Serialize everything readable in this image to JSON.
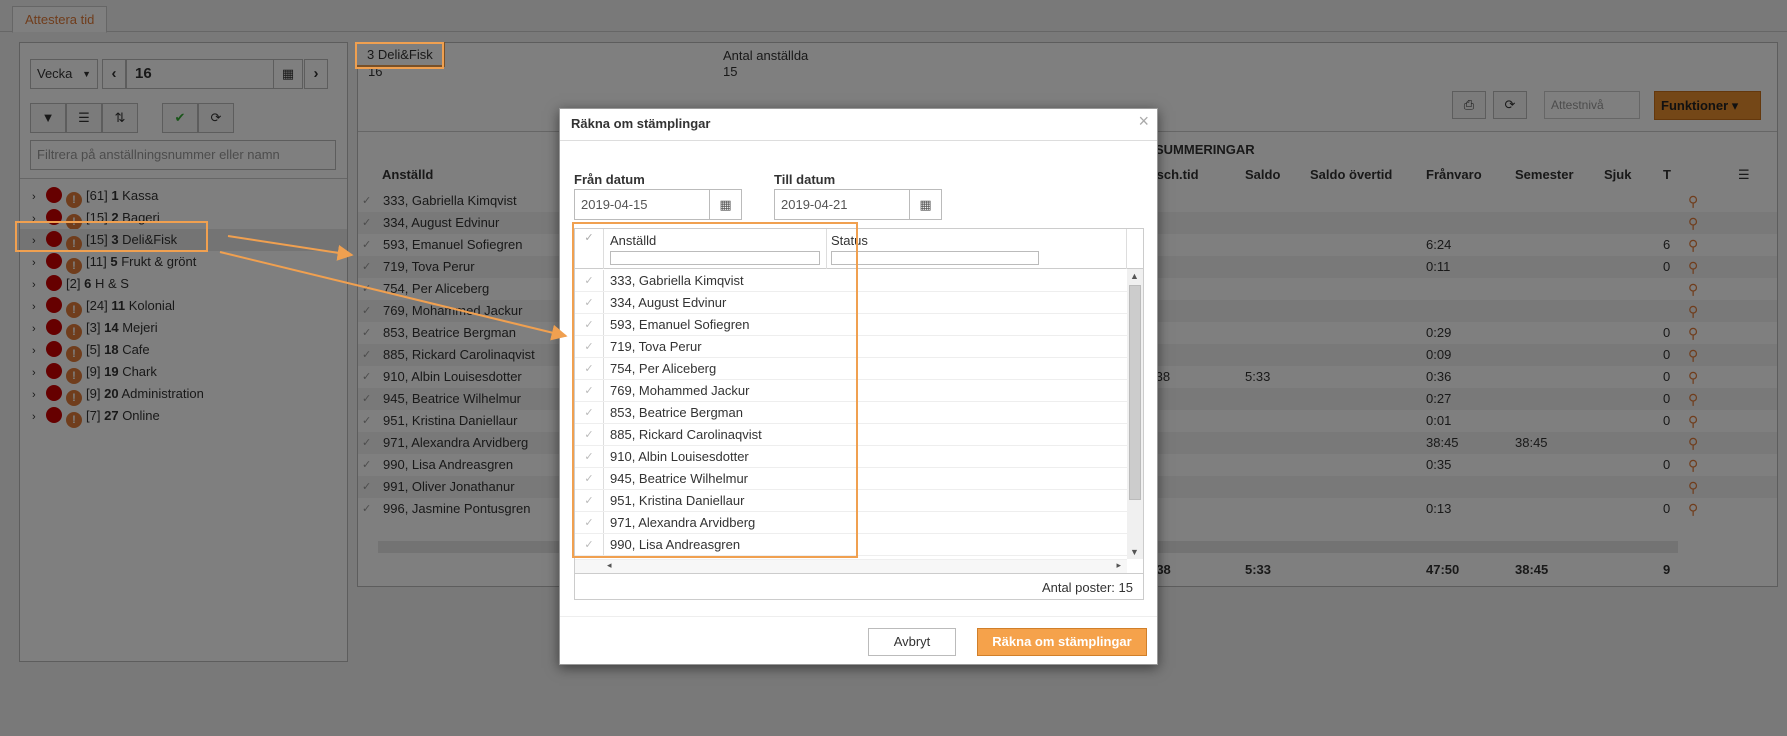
{
  "tabs": [
    {
      "label": "Attestera tid"
    }
  ],
  "left": {
    "period": "Vecka",
    "week": "16",
    "filter_placeholder": "Filtrera på anställningsnummer eller namn",
    "tree": [
      {
        "count": "[61]",
        "num": "1",
        "name": "Kassa"
      },
      {
        "count": "[15]",
        "num": "2",
        "name": "Bageri"
      },
      {
        "count": "[15]",
        "num": "3",
        "name": "Deli&Fisk"
      },
      {
        "count": "[11]",
        "num": "5",
        "name": "Frukt & grönt"
      },
      {
        "count": "[2]",
        "num": "6",
        "name": "H & S"
      },
      {
        "count": "[24]",
        "num": "11",
        "name": "Kolonial"
      },
      {
        "count": "[3]",
        "num": "14",
        "name": "Mejeri"
      },
      {
        "count": "[5]",
        "num": "18",
        "name": "Cafe"
      },
      {
        "count": "[9]",
        "num": "19",
        "name": "Chark"
      },
      {
        "count": "[9]",
        "num": "20",
        "name": "Administration"
      },
      {
        "count": "[7]",
        "num": "27",
        "name": "Online"
      }
    ]
  },
  "main": {
    "selected_badge": "3 Deli&Fisk",
    "info1_value": "16",
    "info2_label": "Antal anställda",
    "info2_value": "15",
    "attest_level": "Attestnivå",
    "functions_label": "Funktioner",
    "summary_title": "SUMMERINGAR",
    "columns": {
      "employee": "Anställd",
      "arb": "rb sch.tid",
      "saldo": "Saldo",
      "saldo_overtid": "Saldo övertid",
      "franvaro": "Frånvaro",
      "semester": "Semester",
      "sjuk": "Sjuk",
      "t": "T"
    },
    "rows": [
      {
        "name": "333, Gabriella Kimqvist",
        "franvaro": "",
        "semester": "",
        "t": ""
      },
      {
        "name": "334, August Edvinur",
        "franvaro": "",
        "semester": "",
        "t": ""
      },
      {
        "name": "593, Emanuel Sofiegren",
        "franvaro": "6:24",
        "semester": "",
        "t": "6"
      },
      {
        "name": "719, Tova Perur",
        "franvaro": "0:11",
        "semester": "",
        "t": "0"
      },
      {
        "name": "754, Per Aliceberg",
        "franvaro": "",
        "semester": "",
        "t": ""
      },
      {
        "name": "769, Mohammed Jackur",
        "franvaro": "",
        "semester": "",
        "t": ""
      },
      {
        "name": "853, Beatrice Bergman",
        "franvaro": "0:29",
        "semester": "",
        "t": "0"
      },
      {
        "name": "885, Rickard Carolinaqvist",
        "franvaro": "0:09",
        "semester": "",
        "t": "0"
      },
      {
        "name": "910, Albin Louisesdotter",
        "arb": ":38",
        "saldo": "5:33",
        "franvaro": "0:36",
        "semester": "",
        "t": "0"
      },
      {
        "name": "945, Beatrice Wilhelmur",
        "franvaro": "0:27",
        "semester": "",
        "t": "0"
      },
      {
        "name": "951, Kristina Daniellaur",
        "franvaro": "0:01",
        "semester": "",
        "t": "0"
      },
      {
        "name": "971, Alexandra Arvidberg",
        "franvaro": "38:45",
        "semester": "38:45",
        "t": ""
      },
      {
        "name": "990, Lisa Andreasgren",
        "franvaro": "0:35",
        "semester": "",
        "t": "0"
      },
      {
        "name": "991, Oliver Jonathanur",
        "franvaro": "",
        "semester": "",
        "t": ""
      },
      {
        "name": "996, Jasmine Pontusgren",
        "franvaro": "0:13",
        "semester": "",
        "t": "0"
      }
    ],
    "totals": {
      "arb": ":38",
      "saldo": "5:33",
      "franvaro": "47:50",
      "semester": "38:45",
      "t": "9"
    }
  },
  "modal": {
    "title": "Räkna om stämplingar",
    "from_label": "Från datum",
    "from_value": "2019-04-15",
    "to_label": "Till datum",
    "to_value": "2019-04-21",
    "col_employee": "Anställd",
    "col_status": "Status",
    "employees": [
      "333, Gabriella Kimqvist",
      "334, August Edvinur",
      "593, Emanuel Sofiegren",
      "719, Tova Perur",
      "754, Per Aliceberg",
      "769, Mohammed Jackur",
      "853, Beatrice Bergman",
      "885, Rickard Carolinaqvist",
      "910, Albin Louisesdotter",
      "945, Beatrice Wilhelmur",
      "951, Kristina Daniellaur",
      "971, Alexandra Arvidberg",
      "990, Lisa Andreasgren"
    ],
    "count_label": "Antal poster: 15",
    "cancel_label": "Avbryt",
    "submit_label": "Räkna om stämplingar"
  },
  "colors": {
    "accent": "#e07b39",
    "highlight": "#f0a050",
    "danger": "#cc0000"
  }
}
